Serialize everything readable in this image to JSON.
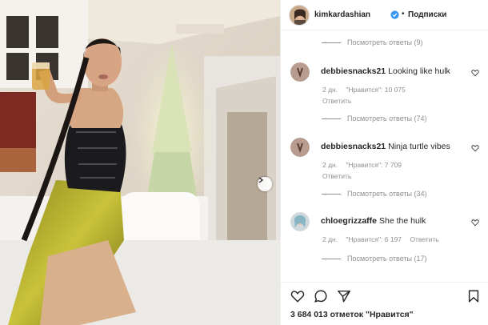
{
  "header": {
    "username": "kimkardashian",
    "separator": "•",
    "follow_label": "Подписки"
  },
  "comments": {
    "top_view_replies": "Посмотреть ответы (9)",
    "items": [
      {
        "username": "debbiesnacks21",
        "text": "Looking like hulk",
        "time": "2 дн.",
        "likes": "\"Нравится\": 10 075",
        "reply_label": "Ответить",
        "view_replies": "Посмотреть ответы (74)"
      },
      {
        "username": "debbiesnacks21",
        "text": "Ninja turtle vibes",
        "time": "2 дн.",
        "likes": "\"Нравится\": 7 709",
        "reply_label": "Ответить",
        "view_replies": "Посмотреть ответы (34)"
      },
      {
        "username": "chloegrizzaffe",
        "text": "She the hulk",
        "time": "2 дн.",
        "likes": "\"Нравится\": 6 197",
        "reply_label": "Ответить",
        "view_replies": "Посмотреть ответы (17)"
      }
    ]
  },
  "actions": {
    "likes_text": "3 684 013 отметок \"Нравится\"",
    "icons": [
      "heart-icon",
      "comment-icon",
      "share-icon",
      "bookmark-icon"
    ]
  },
  "colors": {
    "text": "#262626",
    "muted": "#8e8e8e",
    "verified": "#3897f0",
    "border": "#efefef"
  }
}
